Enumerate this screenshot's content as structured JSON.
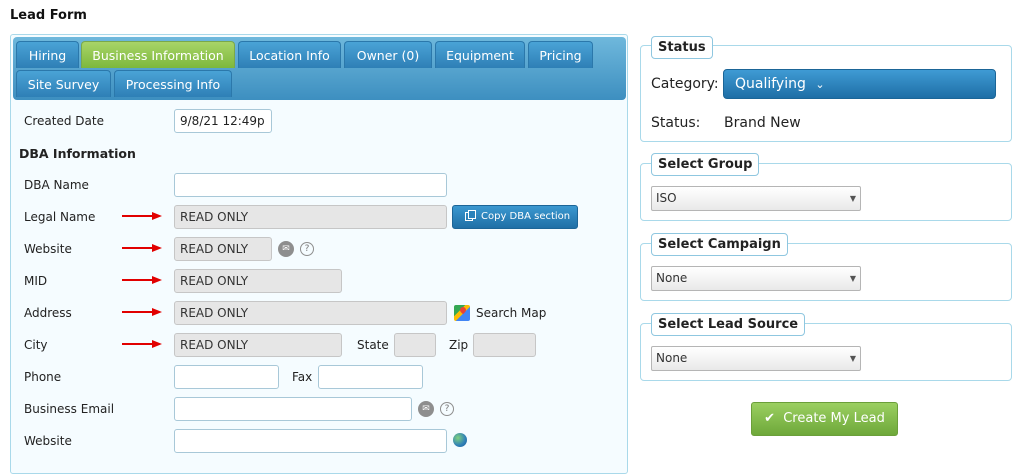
{
  "page": {
    "title": "Lead Form"
  },
  "tabs": {
    "hiring": "Hiring",
    "business": "Business Information",
    "location": "Location Info",
    "owner": "Owner (0)",
    "equipment": "Equipment",
    "pricing": "Pricing",
    "site_survey": "Site Survey",
    "processing": "Processing Info"
  },
  "form": {
    "created_date_label": "Created Date",
    "created_date_value": "9/8/21 12:49p",
    "dba_heading": "DBA Information",
    "dba_name_label": "DBA Name",
    "legal_name_label": "Legal Name",
    "legal_name_value": "READ ONLY",
    "copy_dba_label": "Copy DBA section",
    "website_label": "Website",
    "website_value": "READ ONLY",
    "mid_label": "MID",
    "mid_value": "READ ONLY",
    "address_label": "Address",
    "address_value": "READ ONLY",
    "search_map_label": "Search Map",
    "city_label": "City",
    "city_value": "READ ONLY",
    "state_label": "State",
    "zip_label": "Zip",
    "phone_label": "Phone",
    "fax_label": "Fax",
    "business_email_label": "Business Email",
    "website2_label": "Website",
    "help_glyph": "?"
  },
  "status": {
    "legend": "Status",
    "category_label": "Category:",
    "category_value": "Qualifying",
    "caret": "⌄",
    "status_label": "Status:",
    "status_value": "Brand New"
  },
  "group": {
    "legend": "Select Group",
    "value": "ISO"
  },
  "campaign": {
    "legend": "Select Campaign",
    "value": "None"
  },
  "lead_source": {
    "legend": "Select Lead Source",
    "value": "None"
  },
  "actions": {
    "check": "✔",
    "create_label": "Create My Lead"
  },
  "icons": {
    "arrow": "arrow-right-icon",
    "copy": "copy-icon",
    "contact": "contact-card-icon",
    "help": "help-icon",
    "map": "map-icon",
    "globe": "globe-icon",
    "dropdown": "chevron-down-icon",
    "check": "check-icon"
  },
  "colors": {
    "tab_bar": "#3d8fc0",
    "tab_active": "#7db83c",
    "primary_button": "#1e6ea6",
    "create_button": "#6ea83a",
    "arrow": "#e10000",
    "panel_border": "#a9d9ea"
  }
}
